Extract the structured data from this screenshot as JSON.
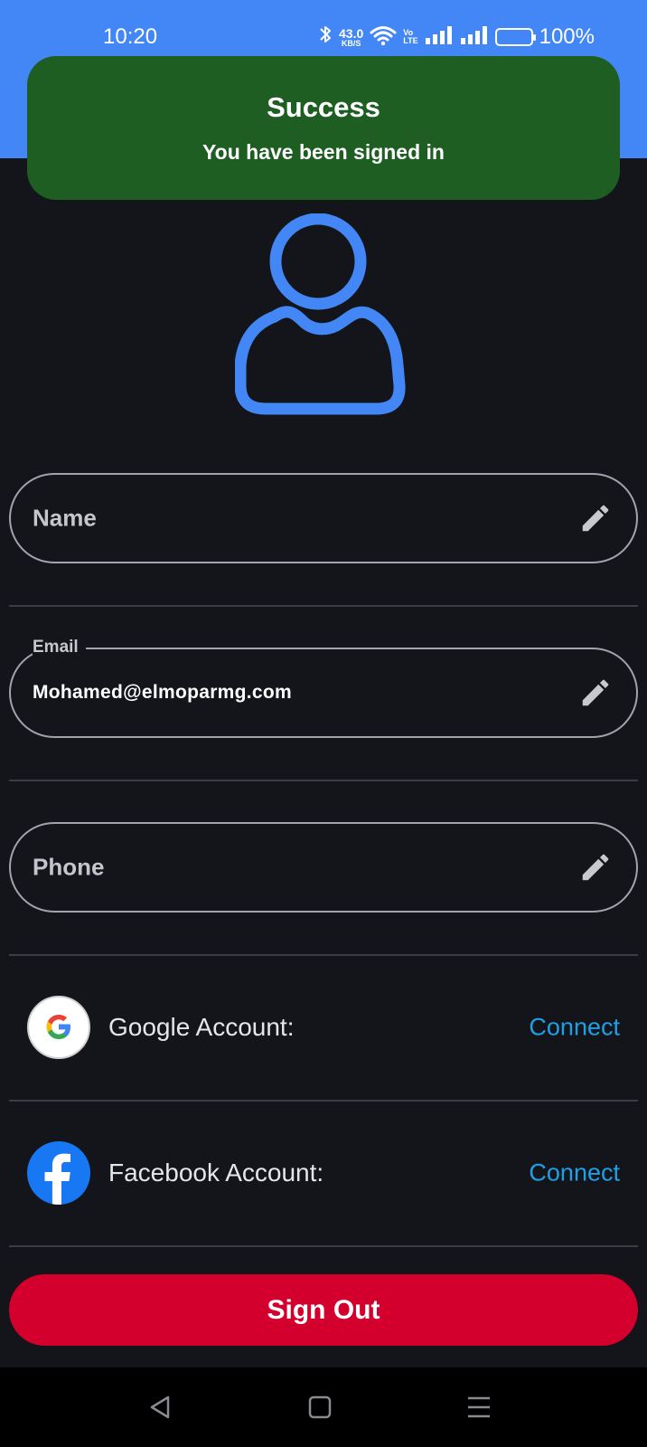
{
  "status_bar": {
    "time": "10:20",
    "net_speed_value": "43.0",
    "net_speed_unit": "KB/S",
    "volte_top": "Vo",
    "volte_bottom": "LTE",
    "battery": "100%",
    "icons": [
      "bluetooth-icon",
      "wifi-icon",
      "volte-icon",
      "signal-icon",
      "signal-icon",
      "battery-icon"
    ]
  },
  "toast": {
    "title": "Success",
    "message": "You have been signed in",
    "color": "#1e5e22"
  },
  "profile": {
    "avatar_icon": "person-outline-icon",
    "accent": "#4287f5"
  },
  "fields": {
    "name": {
      "placeholder": "Name",
      "value": ""
    },
    "email": {
      "label": "Email",
      "value": "Mohamed@elmoparmg.com"
    },
    "phone": {
      "placeholder": "Phone",
      "value": ""
    },
    "edit_icon": "pencil-icon"
  },
  "accounts": [
    {
      "label": "Google Account:",
      "action": "Connect",
      "icon": "google-logo-icon"
    },
    {
      "label": "Facebook Account:",
      "action": "Connect",
      "icon": "facebook-logo-icon"
    }
  ],
  "actions": {
    "sign_out": "Sign Out",
    "sign_out_color": "#d3002d",
    "link_color": "#1ea0e6"
  },
  "nav": [
    "back-icon",
    "home-icon",
    "recents-icon"
  ]
}
